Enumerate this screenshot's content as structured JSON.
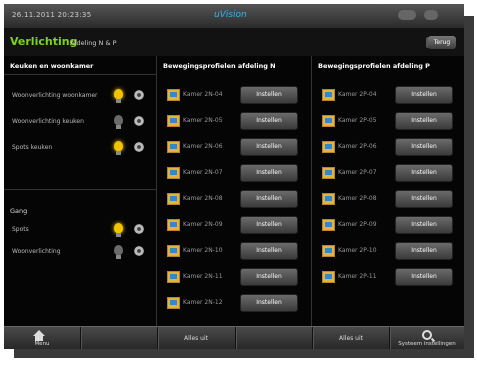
{
  "status": {
    "datetime": "26.11.2011   20:23:35",
    "logo_text": "uVision"
  },
  "title": {
    "main": "Verlichting",
    "sub": "Afdeling N & P",
    "back_label": "Terug"
  },
  "left": {
    "kitchen_header": "Keuken en woonkamer",
    "kitchen_items": [
      {
        "label": "Woonverlichting woonkamer",
        "state": "on"
      },
      {
        "label": "Woonverlichting keuken",
        "state": "off"
      },
      {
        "label": "Spots keuken",
        "state": "on"
      }
    ],
    "gang_header": "Gang",
    "gang_items": [
      {
        "label": "Spots",
        "state": "on"
      },
      {
        "label": "Woonverlichting",
        "state": "off"
      }
    ]
  },
  "middle": {
    "header": "Bewegingsprofielen afdeling N",
    "button_label": "Instellen",
    "rooms": [
      "Kamer 2N-04",
      "Kamer 2N-05",
      "Kamer 2N-06",
      "Kamer 2N-07",
      "Kamer 2N-08",
      "Kamer 2N-09",
      "Kamer 2N-10",
      "Kamer 2N-11",
      "Kamer 2N-12"
    ]
  },
  "right": {
    "header": "Bewegingsprofielen afdeling P",
    "button_label": "Instellen",
    "rooms": [
      "Kamer 2P-04",
      "Kamer 2P-05",
      "Kamer 2P-06",
      "Kamer 2P-07",
      "Kamer 2P-08",
      "Kamer 2P-09",
      "Kamer 2P-10",
      "Kamer 2P-11"
    ]
  },
  "bottom": {
    "menu": "Menu",
    "all_off_n": "Alles uit",
    "all_off_p": "Alles uit",
    "settings": "Systeem instellingen"
  },
  "colors": {
    "accent_green": "#7ed321",
    "bulb_on": "#f2c300"
  }
}
